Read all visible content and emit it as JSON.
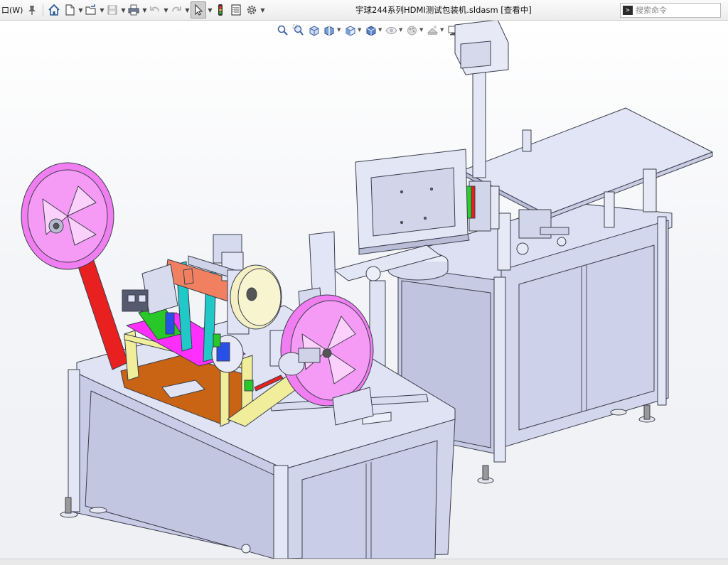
{
  "app": {
    "menu_window_label": "口(W)",
    "document_title": "宇球244系列HDMI测试包装机.sldasm [查看中]"
  },
  "toolbar": {
    "buttons": [
      {
        "name": "pin-icon"
      },
      {
        "name": "home-icon"
      },
      {
        "name": "new-document-icon"
      },
      {
        "name": "open-folder-icon"
      },
      {
        "name": "save-icon"
      },
      {
        "name": "print-icon"
      },
      {
        "name": "undo-icon"
      },
      {
        "name": "redo-icon"
      },
      {
        "name": "select-pointer-icon"
      },
      {
        "name": "rebuild-traffic-light-icon"
      },
      {
        "name": "file-properties-icon"
      },
      {
        "name": "options-gear-icon"
      }
    ]
  },
  "search": {
    "placeholder": "搜索命令",
    "value": ""
  },
  "heads_up_toolbar": {
    "buttons": [
      "zoom-to-fit-icon",
      "zoom-to-area-icon",
      "previous-view-icon",
      "section-view-icon",
      "view-orientation-icon",
      "display-style-icon",
      "hide-show-items-icon",
      "edit-appearance-icon",
      "apply-scene-icon",
      "view-settings-icon"
    ]
  },
  "colors": {
    "machine_body": "#d8dcf0",
    "machine_edge": "#4a4d5c",
    "reel": "#f07ef0",
    "red_arm": "#e82020",
    "yellow_part": "#f0ee9a",
    "cyan_part": "#20c8c8",
    "orange_plate": "#c86414",
    "magenta_plate": "#ff30ff",
    "green_part": "#28c828",
    "salmon_part": "#f08060"
  }
}
